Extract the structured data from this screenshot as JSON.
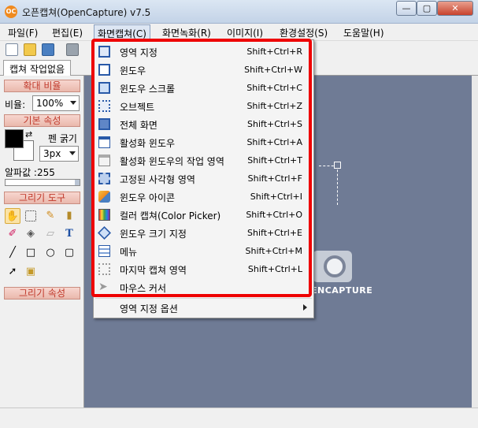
{
  "window": {
    "title": "오픈캡쳐(OpenCapture) v7.5",
    "app_icon": "OC",
    "min": "—",
    "max": "▢",
    "close": "✕"
  },
  "menubar": [
    "파일(F)",
    "편집(E)",
    "화면캡쳐(C)",
    "화면녹화(R)",
    "이미지(I)",
    "환경설정(S)",
    "도움말(H)"
  ],
  "tab": "캡쳐 작업없음",
  "left": {
    "zoom_title": "확대 비율",
    "zoom_label": "비율:",
    "zoom_value": "100%",
    "props_title": "기본 속성",
    "pen_label": "펜 굵기",
    "pen_value": "3px",
    "alpha_label": "알파값 :255",
    "tools_title": "그리기 도구",
    "draw_props_title": "그리기 속성"
  },
  "canvas": {
    "logo_text": "ENCAPTURE"
  },
  "dropdown": {
    "items": [
      {
        "label": "영역 지정",
        "shortcut": "Shift+Ctrl+R",
        "icon": "region-icon"
      },
      {
        "label": "윈도우",
        "shortcut": "Shift+Ctrl+W",
        "icon": "window-icon"
      },
      {
        "label": "윈도우 스크롤",
        "shortcut": "Shift+Ctrl+C",
        "icon": "window-scroll-icon"
      },
      {
        "label": "오브젝트",
        "shortcut": "Shift+Ctrl+Z",
        "icon": "object-icon"
      },
      {
        "label": "전체 화면",
        "shortcut": "Shift+Ctrl+S",
        "icon": "fullscreen-icon"
      },
      {
        "label": "활성화 윈도우",
        "shortcut": "Shift+Ctrl+A",
        "icon": "active-window-icon"
      },
      {
        "label": "활성화 윈도우의 작업 영역",
        "shortcut": "Shift+Ctrl+T",
        "icon": "client-area-icon"
      },
      {
        "label": "고정된 사각형 영역",
        "shortcut": "Shift+Ctrl+F",
        "icon": "fixed-rect-icon"
      },
      {
        "label": "윈도우 아이콘",
        "shortcut": "Shift+Ctrl+I",
        "icon": "window-icon-capture-icon"
      },
      {
        "label": "컬러 캡쳐(Color Picker)",
        "shortcut": "Shift+Ctrl+O",
        "icon": "color-picker-icon"
      },
      {
        "label": "윈도우 크기 지정",
        "shortcut": "Shift+Ctrl+E",
        "icon": "window-size-icon"
      },
      {
        "label": "메뉴",
        "shortcut": "Shift+Ctrl+M",
        "icon": "menu-icon"
      },
      {
        "label": "마지막 캡쳐 영역",
        "shortcut": "Shift+Ctrl+L",
        "icon": "last-region-icon"
      },
      {
        "label": "마우스 커서",
        "shortcut": "",
        "icon": "cursor-icon"
      }
    ],
    "submenu_label": "영역 지정 옵션"
  },
  "colors": {
    "accent_red": "#ee0000",
    "canvas": "#6f7b95",
    "section_text": "#c0392b"
  }
}
